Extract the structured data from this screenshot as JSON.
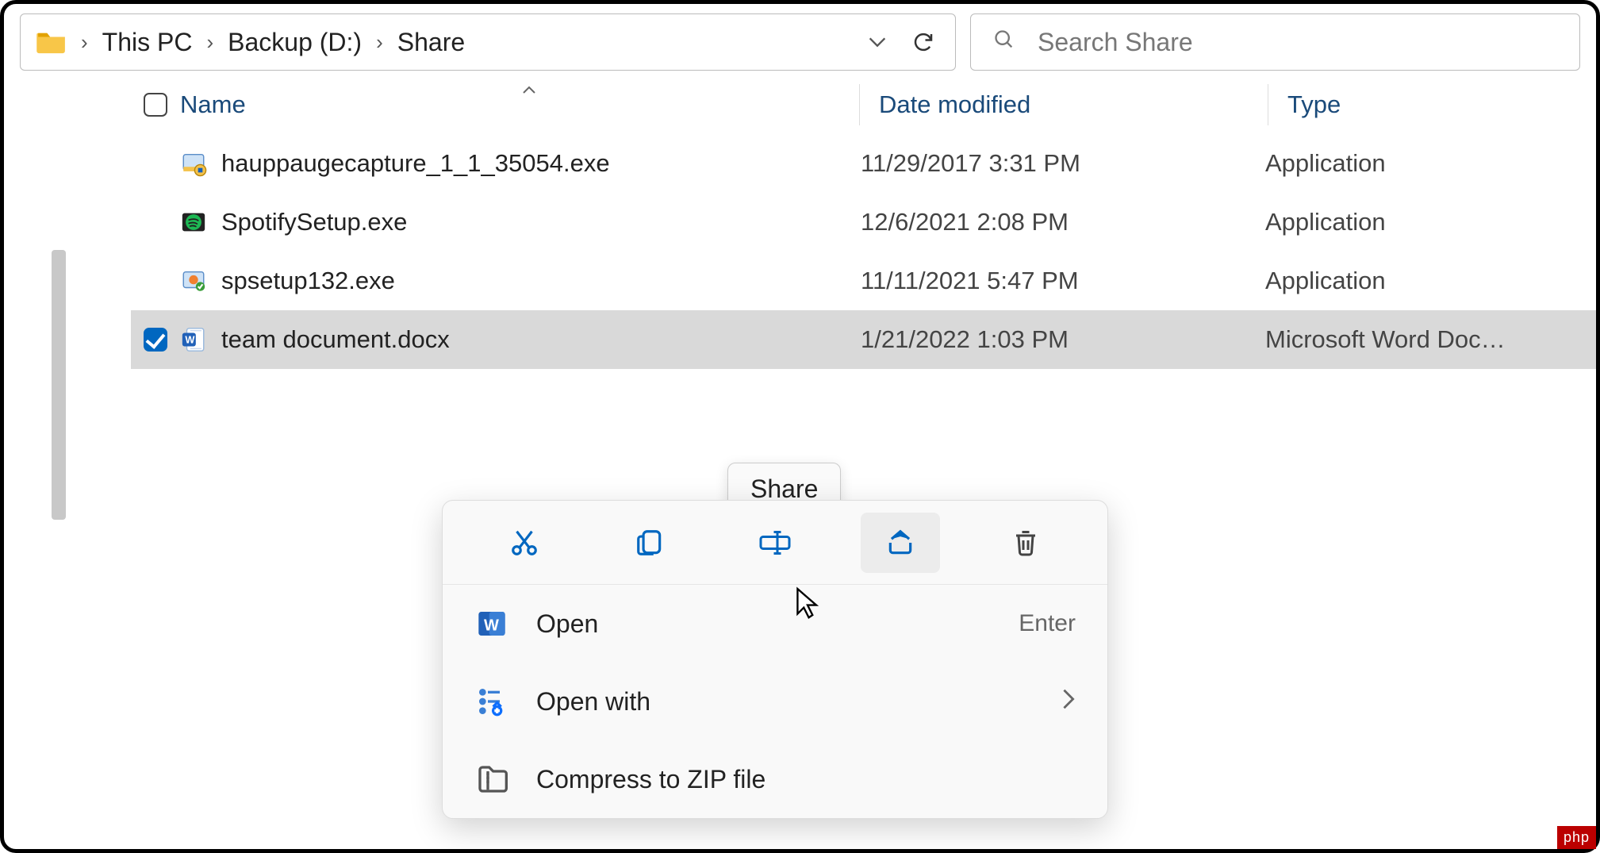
{
  "breadcrumbs": [
    "This PC",
    "Backup (D:)",
    "Share"
  ],
  "search": {
    "placeholder": "Search Share"
  },
  "columns": {
    "name": "Name",
    "date": "Date modified",
    "type": "Type"
  },
  "rows": [
    {
      "name": "hauppaugecapture_1_1_35054.exe",
      "date": "11/29/2017 3:31 PM",
      "type": "Application",
      "icon": "installer",
      "selected": false
    },
    {
      "name": "SpotifySetup.exe",
      "date": "12/6/2021 2:08 PM",
      "type": "Application",
      "icon": "spotify",
      "selected": false
    },
    {
      "name": "spsetup132.exe",
      "date": "11/11/2021 5:47 PM",
      "type": "Application",
      "icon": "installer2",
      "selected": false
    },
    {
      "name": "team document.docx",
      "date": "1/21/2022 1:03 PM",
      "type": "Microsoft Word Doc…",
      "icon": "word",
      "selected": true
    }
  ],
  "tooltip": "Share",
  "context_menu": {
    "icon_buttons": [
      "cut",
      "copy",
      "rename",
      "share",
      "delete"
    ],
    "hover": "share",
    "items": [
      {
        "icon": "word",
        "label": "Open",
        "accel": "Enter"
      },
      {
        "icon": "openwith",
        "label": "Open with",
        "submenu": true
      },
      {
        "icon": "zip",
        "label": "Compress to ZIP file"
      }
    ]
  },
  "watermark": "php"
}
